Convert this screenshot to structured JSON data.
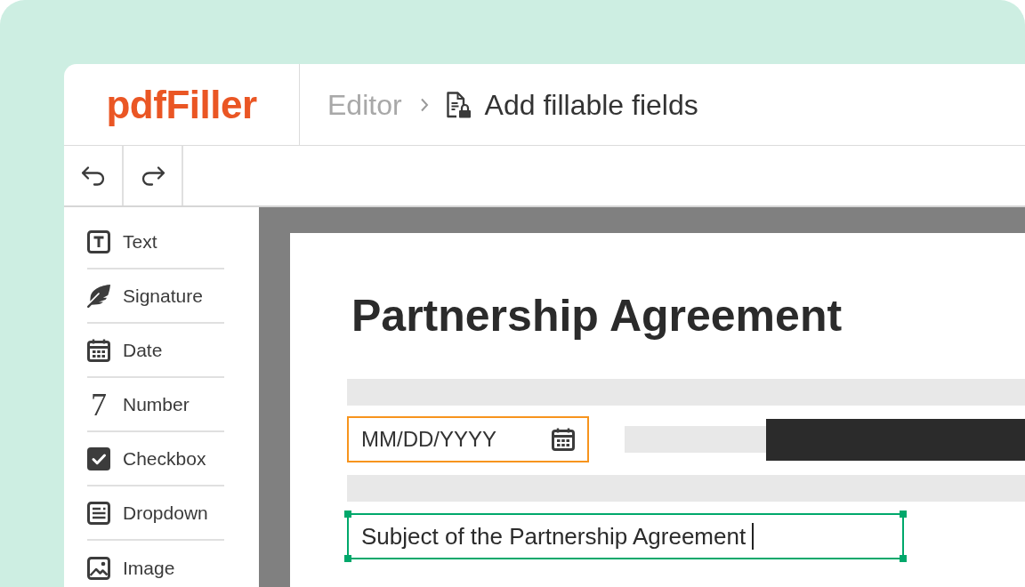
{
  "logo": {
    "text": "pdfFiller"
  },
  "breadcrumb": {
    "parent": "Editor",
    "current": "Add fillable fields"
  },
  "sidebar": {
    "items": [
      {
        "kind": "text",
        "label": "Text"
      },
      {
        "kind": "signature",
        "label": "Signature"
      },
      {
        "kind": "date",
        "label": "Date"
      },
      {
        "kind": "number",
        "label": "Number",
        "glyph": "7"
      },
      {
        "kind": "checkbox",
        "label": "Checkbox"
      },
      {
        "kind": "dropdown",
        "label": "Dropdown"
      },
      {
        "kind": "image",
        "label": "Image"
      }
    ]
  },
  "document": {
    "title": "Partnership Agreement",
    "date_field": {
      "placeholder": "MM/DD/YYYY"
    },
    "text_field": {
      "value": "Subject of the Partnership Agreement",
      "selected": true
    }
  }
}
